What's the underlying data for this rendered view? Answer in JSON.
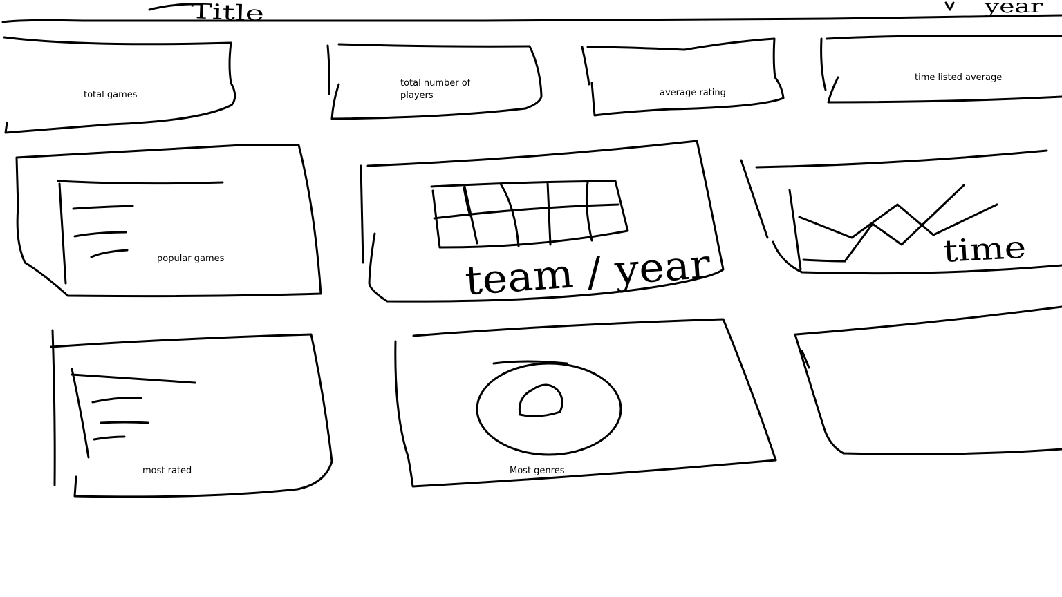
{
  "header": {
    "title_label": "Title",
    "filter_label": "year"
  },
  "cards": {
    "total_games": "total games",
    "total_players": "total number of players",
    "average_rating": "average rating",
    "time_listed_average": "time listed average"
  },
  "panels": {
    "popular_games": "popular games",
    "team_year": "team / year",
    "time": "time",
    "most_rated": "most rated",
    "most_genres": "Most genres"
  }
}
